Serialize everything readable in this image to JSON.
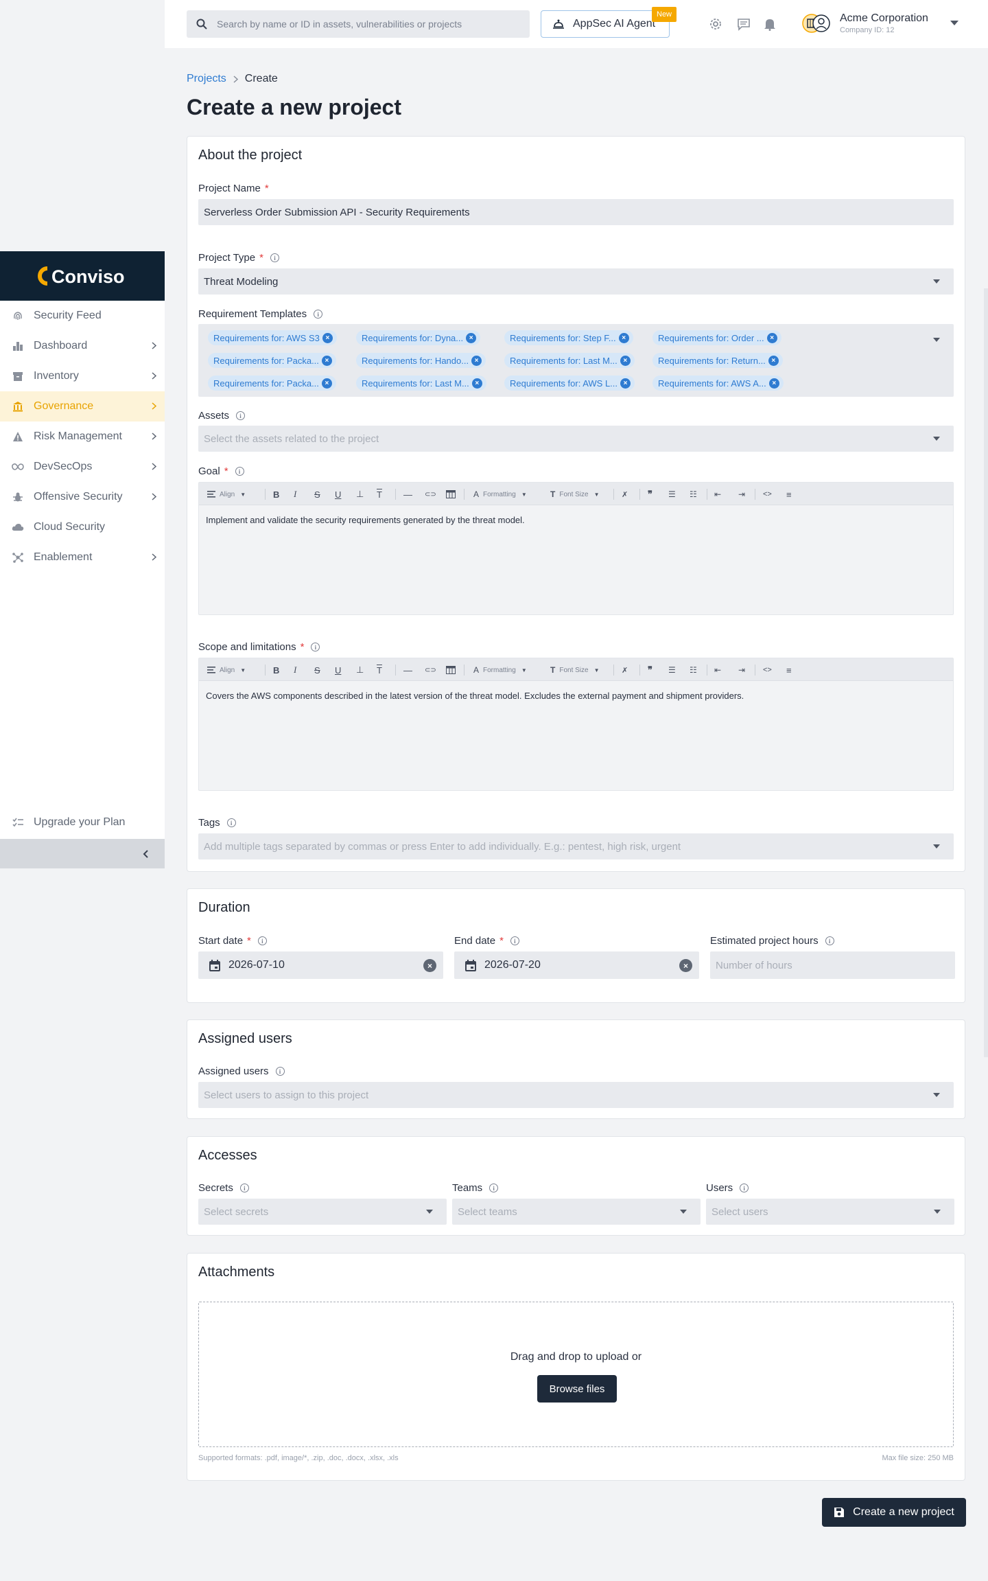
{
  "header": {
    "search_placeholder": "Search by name or ID in assets, vulnerabilities or projects",
    "ai_button": "AppSec AI Agent",
    "new_badge": "New",
    "company_name": "Acme Corporation",
    "company_id": "Company ID: 12"
  },
  "sidebar": {
    "logo": "Conviso",
    "items": [
      {
        "label": "Security Feed",
        "icon": "fingerprint-icon",
        "chevron": false
      },
      {
        "label": "Dashboard",
        "icon": "bar-chart-icon",
        "chevron": true
      },
      {
        "label": "Inventory",
        "icon": "archive-icon",
        "chevron": true
      },
      {
        "label": "Governance",
        "icon": "bank-icon",
        "chevron": true,
        "active": true
      },
      {
        "label": "Risk Management",
        "icon": "warning-icon",
        "chevron": true
      },
      {
        "label": "DevSecOps",
        "icon": "infinity-icon",
        "chevron": true
      },
      {
        "label": "Offensive Security",
        "icon": "bug-icon",
        "chevron": true
      },
      {
        "label": "Cloud Security",
        "icon": "cloud-icon",
        "chevron": false
      },
      {
        "label": "Enablement",
        "icon": "hub-icon",
        "chevron": true
      }
    ],
    "upgrade": "Upgrade your Plan"
  },
  "breadcrumb": {
    "parent": "Projects",
    "current": "Create"
  },
  "page_title": "Create a new project",
  "about": {
    "title": "About the project",
    "project_name_label": "Project Name",
    "project_name_value": "Serverless Order Submission API - Security Requirements",
    "project_type_label": "Project Type",
    "project_type_value": "Threat Modeling",
    "templates_label": "Requirement Templates",
    "templates": [
      "Requirements for: AWS S3",
      "Requirements for: Dyna...",
      "Requirements for: Step F...",
      "Requirements for: Order ...",
      "Requirements for: Packa...",
      "Requirements for: Hando...",
      "Requirements for: Last M...",
      "Requirements for: Return...",
      "Requirements for: Packa...",
      "Requirements for: Last M...",
      "Requirements for: AWS L...",
      "Requirements for: AWS A..."
    ],
    "assets_label": "Assets",
    "assets_placeholder": "Select the assets related to the project",
    "goal_label": "Goal",
    "goal_text": "Implement and validate the security requirements generated by the threat model.",
    "scope_label": "Scope and limitations",
    "scope_text": "Covers the AWS components described in the latest version of the threat model. Excludes the external payment and shipment providers.",
    "tags_label": "Tags",
    "tags_placeholder": "Add multiple tags separated by commas or press Enter to add individually. E.g.: pentest, high risk, urgent"
  },
  "toolbar": {
    "align": "Align",
    "formatting": "Formatting",
    "font_size": "Font Size"
  },
  "duration": {
    "title": "Duration",
    "start_label": "Start date",
    "start_value": "2026-07-10",
    "end_label": "End date",
    "end_value": "2026-07-20",
    "hours_label": "Estimated project hours",
    "hours_placeholder": "Number of hours"
  },
  "assigned": {
    "title": "Assigned users",
    "label": "Assigned users",
    "placeholder": "Select users to assign to this project"
  },
  "accesses": {
    "title": "Accesses",
    "secrets_label": "Secrets",
    "secrets_placeholder": "Select secrets",
    "teams_label": "Teams",
    "teams_placeholder": "Select teams",
    "users_label": "Users",
    "users_placeholder": "Select users"
  },
  "attachments": {
    "title": "Attachments",
    "drop_text": "Drag and drop to upload or",
    "browse": "Browse files",
    "formats": "Supported formats: .pdf, image/*, .zip, .doc, .docx, .xlsx, .xls",
    "max_size": "Max file size: 250 MB"
  },
  "create_button": "Create a new project",
  "colors": {
    "accent": "#F5A800",
    "primary": "#1E2A3A",
    "link": "#2E7BD1"
  }
}
